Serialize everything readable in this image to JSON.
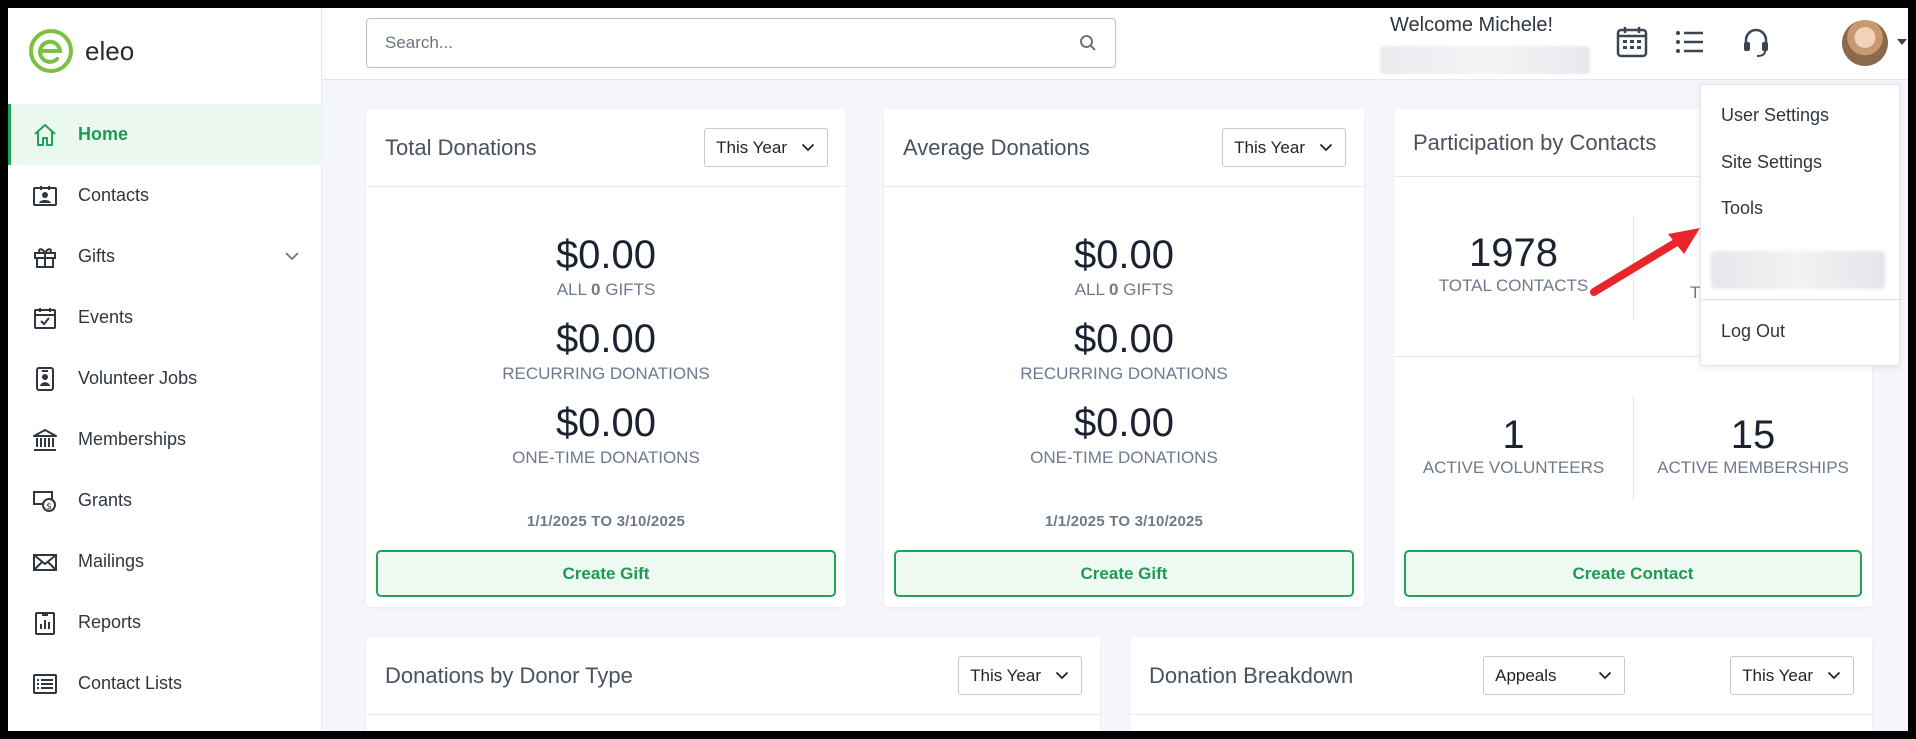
{
  "app": {
    "logo_text": "eleo",
    "brand_color": "#21a257"
  },
  "sidebar": {
    "items": [
      {
        "label": "Home",
        "icon": "home-icon",
        "active": true
      },
      {
        "label": "Contacts",
        "icon": "contacts-card-icon"
      },
      {
        "label": "Gifts",
        "icon": "gift-icon",
        "expandable": true
      },
      {
        "label": "Events",
        "icon": "calendar-check-icon"
      },
      {
        "label": "Volunteer Jobs",
        "icon": "badge-icon"
      },
      {
        "label": "Memberships",
        "icon": "institution-icon"
      },
      {
        "label": "Grants",
        "icon": "money-icon"
      },
      {
        "label": "Mailings",
        "icon": "envelope-icon"
      },
      {
        "label": "Reports",
        "icon": "report-chart-icon"
      },
      {
        "label": "Contact Lists",
        "icon": "list-icon"
      }
    ]
  },
  "header": {
    "search_placeholder": "Search...",
    "welcome": "Welcome Michele!",
    "icons": [
      "calendar-grid-icon",
      "list-icon",
      "headset-icon",
      "avatar"
    ]
  },
  "user_menu": {
    "items": [
      "User Settings",
      "Site Settings",
      "Tools",
      "Log Out"
    ]
  },
  "cards": {
    "total": {
      "title": "Total Donations",
      "period": "This Year",
      "stats": [
        {
          "value": "$0.00",
          "label_pre": "ALL ",
          "label_num": "0",
          "label_post": " GIFTS"
        },
        {
          "value": "$0.00",
          "label": "RECURRING DONATIONS"
        },
        {
          "value": "$0.00",
          "label": "ONE-TIME DONATIONS"
        }
      ],
      "range": "1/1/2025 TO 3/10/2025",
      "button": "Create Gift"
    },
    "average": {
      "title": "Average Donations",
      "period": "This Year",
      "stats": [
        {
          "value": "$0.00",
          "label_pre": "ALL ",
          "label_num": "0",
          "label_post": " GIFTS"
        },
        {
          "value": "$0.00",
          "label": "RECURRING DONATIONS"
        },
        {
          "value": "$0.00",
          "label": "ONE-TIME DONATIONS"
        }
      ],
      "range": "1/1/2025 TO 3/10/2025",
      "button": "Create Gift"
    },
    "participation": {
      "title": "Participation by Contacts",
      "stats": [
        {
          "value": "1978",
          "label": "TOTAL CONTACTS"
        },
        {
          "value": "",
          "label": "T"
        },
        {
          "value": "1",
          "label": "ACTIVE VOLUNTEERS"
        },
        {
          "value": "15",
          "label": "ACTIVE MEMBERSHIPS"
        }
      ],
      "button": "Create Contact"
    },
    "donor_type": {
      "title": "Donations by Donor Type",
      "period": "This Year"
    },
    "breakdown": {
      "title": "Donation Breakdown",
      "group": "Appeals",
      "period": "This Year"
    }
  },
  "annotation": {
    "arrow_color": "#e8262a"
  }
}
